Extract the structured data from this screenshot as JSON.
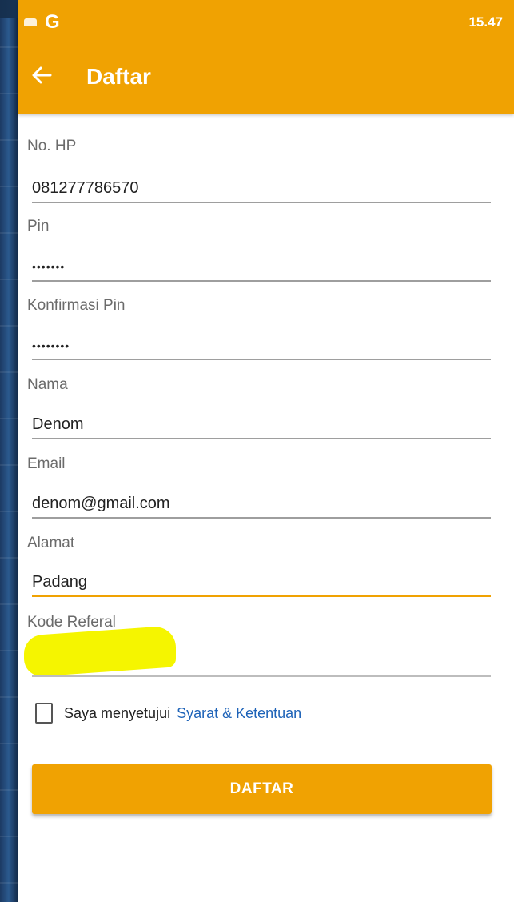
{
  "status_bar": {
    "time": "15.47",
    "app_icon": "G"
  },
  "header": {
    "title": "Daftar",
    "back_icon": "arrow-left-icon"
  },
  "form": {
    "phone": {
      "label": "No. HP",
      "value": "081277786570"
    },
    "pin": {
      "label": "Pin",
      "value": "•••••••"
    },
    "confirm_pin": {
      "label": "Konfirmasi Pin",
      "value": "••••••••"
    },
    "name": {
      "label": "Nama",
      "value": "Denom"
    },
    "email": {
      "label": "Email",
      "value": "denom@gmail.com"
    },
    "address": {
      "label": "Alamat",
      "value": "Padang"
    },
    "referral": {
      "label": "Kode Referal",
      "value": ""
    }
  },
  "terms": {
    "text": "Saya menyetujui",
    "link": "Syarat & Ketentuan",
    "checked": false
  },
  "submit_label": "DAFTAR",
  "colors": {
    "accent": "#f0a202",
    "link": "#1e63b8",
    "highlight": "#f5f500"
  }
}
